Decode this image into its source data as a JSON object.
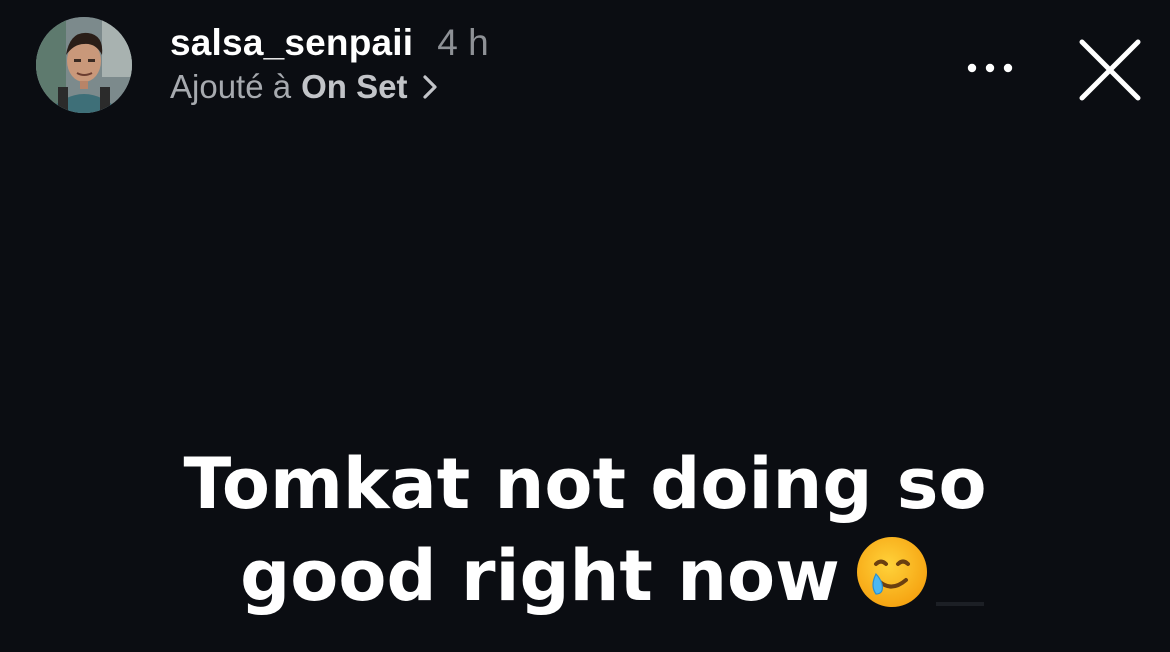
{
  "header": {
    "username": "salsa_senpaii",
    "time_ago": "4 h",
    "added_prefix": "Ajouté à",
    "collection_name": "On Set",
    "more_icon": "more-horizontal-icon",
    "close_icon": "close-icon",
    "chevron_icon": "chevron-right-icon"
  },
  "story": {
    "caption_line1": "Tomkat not doing so",
    "caption_line2": "good right now",
    "emoji": "smiling-face-with-tear-icon"
  },
  "colors": {
    "background": "#0b0d12",
    "text_primary": "#ffffff",
    "text_secondary": "#8e9196"
  }
}
